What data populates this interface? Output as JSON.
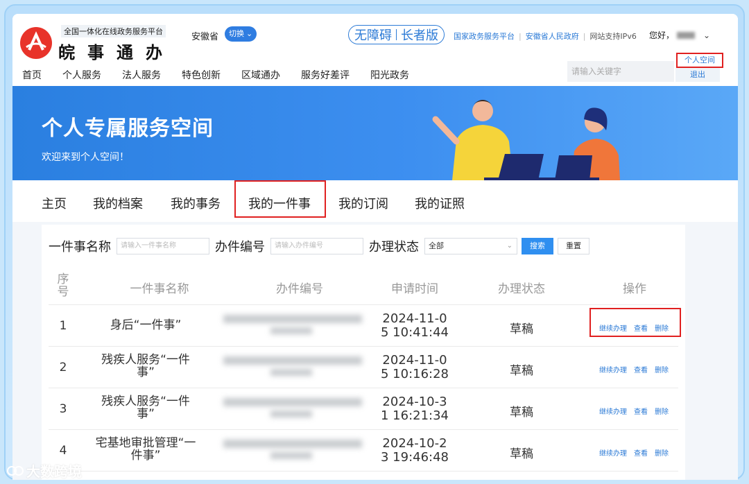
{
  "header": {
    "platform_tag": "全国一体化在线政务服务平台",
    "site_name": "皖事通办",
    "region": "安徽省",
    "switch_label": "切换",
    "accessibility": "无障碍",
    "elder_mode": "长者版",
    "links": [
      "国家政务服务平台",
      "安徽省人民政府"
    ],
    "ipv6": "网站支持IPv6",
    "greeting": "您好，",
    "personal_space": "个人空间",
    "logout": "退出",
    "search_placeholder": "请输入关键字"
  },
  "nav": [
    "首页",
    "个人服务",
    "法人服务",
    "特色创新",
    "区域通办",
    "服务好差评",
    "阳光政务"
  ],
  "banner": {
    "title": "个人专属服务空间",
    "subtitle": "欢迎来到个人空间！"
  },
  "tabs": [
    "主页",
    "我的档案",
    "我的事务",
    "我的一件事",
    "我的订阅",
    "我的证照"
  ],
  "active_tab": "我的一件事",
  "filters": {
    "name_label": "一件事名称",
    "name_placeholder": "请输入一件事名称",
    "code_label": "办件编号",
    "code_placeholder": "请输入办件编号",
    "status_label": "办理状态",
    "status_value": "全部",
    "search_btn": "搜索",
    "reset_btn": "重置"
  },
  "table": {
    "headers": [
      "序号",
      "一件事名称",
      "办件编号",
      "申请时间",
      "办理状态",
      "操作"
    ],
    "rows": [
      {
        "no": "1",
        "name_l1": "身后“一件事”",
        "name_l2": "",
        "time_l1": "2024-11-0",
        "time_l2": "5 10:41:44",
        "status": "草稿"
      },
      {
        "no": "2",
        "name_l1": "残疾人服务“一件",
        "name_l2": "事”",
        "time_l1": "2024-11-0",
        "time_l2": "5 10:16:28",
        "status": "草稿"
      },
      {
        "no": "3",
        "name_l1": "残疾人服务“一件",
        "name_l2": "事”",
        "time_l1": "2024-10-3",
        "time_l2": "1 16:21:34",
        "status": "草稿"
      },
      {
        "no": "4",
        "name_l1": "宅基地审批管理“一",
        "name_l2": "件事”",
        "time_l1": "2024-10-2",
        "time_l2": "3 19:46:48",
        "status": "草稿"
      }
    ],
    "ops": [
      "继续办理",
      "查看",
      "删除"
    ]
  },
  "watermark": "大数跨境",
  "colors": {
    "accent": "#2b7ad6",
    "highlight": "#e02020",
    "banner": "#2a7fe0"
  }
}
